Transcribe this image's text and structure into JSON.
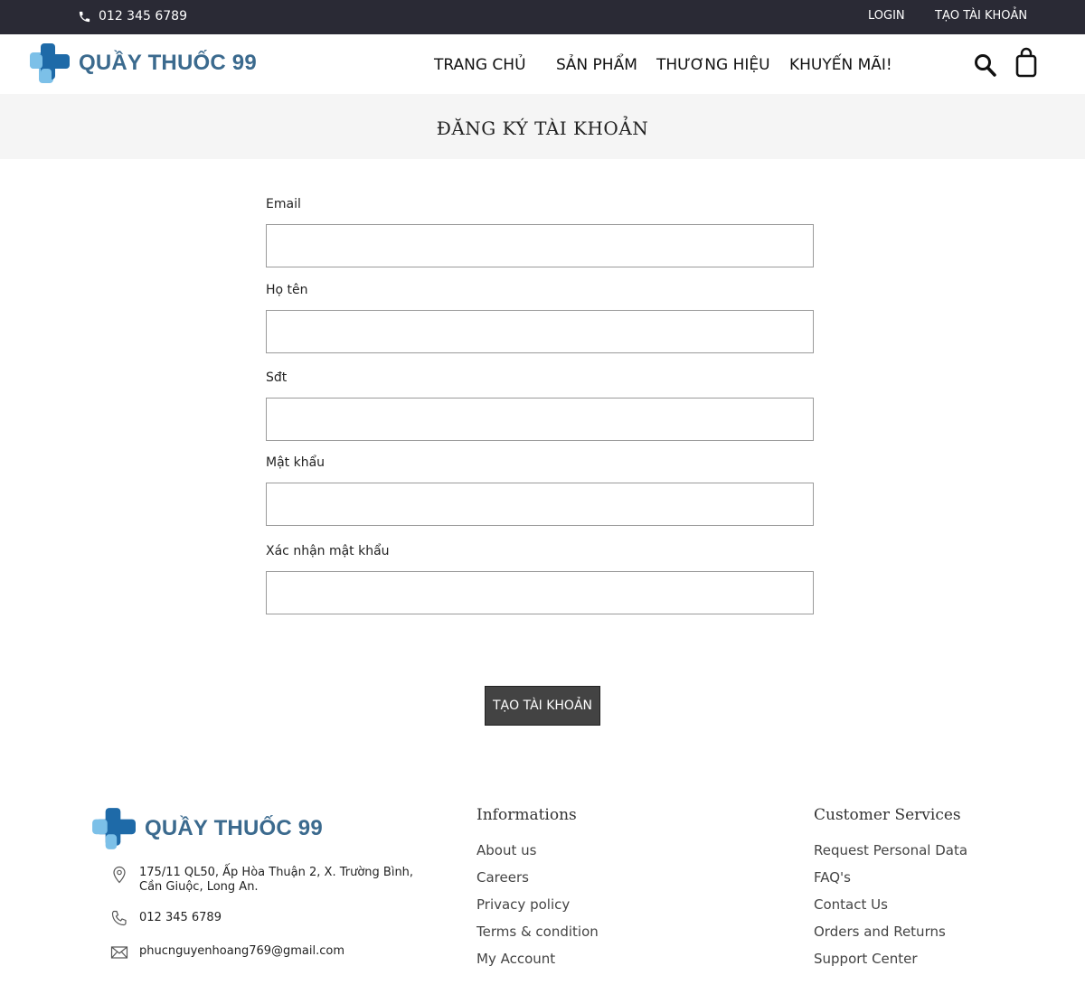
{
  "topbar": {
    "phone": "012 345 6789",
    "login": "LOGIN",
    "register": "TẠO TÀI KHOẢN"
  },
  "header": {
    "brand": "QUẦY THUỐC 99",
    "nav": [
      "TRANG CHỦ",
      "SẢN PHẨM",
      "THƯƠNG HIỆU",
      "KHUYẾN MÃI!"
    ],
    "icons": {
      "search": "search-icon",
      "cart": "shopping-bag-icon"
    }
  },
  "page": {
    "title": "ĐĂNG KÝ TÀI KHOẢN"
  },
  "form": {
    "fields": [
      {
        "label": "Email",
        "value": ""
      },
      {
        "label": "Họ tên",
        "value": ""
      },
      {
        "label": "Sđt",
        "value": ""
      },
      {
        "label": "Mật khẩu",
        "value": ""
      },
      {
        "label": "Xác nhận mật khẩu",
        "value": ""
      }
    ],
    "submit": "TẠO TÀI KHOẢN"
  },
  "footer": {
    "brand": "QUẦY THUỐC 99",
    "address_line1": "175/11 QL50, Ấp Hòa Thuận 2, X. Trường Bình,",
    "address_line2": "Cần Giuộc, Long An.",
    "phone": "012 345 6789",
    "email": "phucnguyenhoang769@gmail.com",
    "informations": {
      "title": "Informations",
      "links": [
        "About us",
        "Careers",
        "Privacy policy",
        "Terms & condition",
        "My Account"
      ]
    },
    "services": {
      "title": "Customer Services",
      "links": [
        "Request Personal Data",
        "FAQ's",
        "Contact Us",
        "Orders and Returns",
        "Support Center"
      ]
    }
  },
  "colors": {
    "topbar_bg": "#2a2a35",
    "brand_text": "#3b6a8e",
    "logo_dark": "#1e6aa8",
    "logo_light": "#7cc0e8",
    "button_bg": "#434343"
  }
}
